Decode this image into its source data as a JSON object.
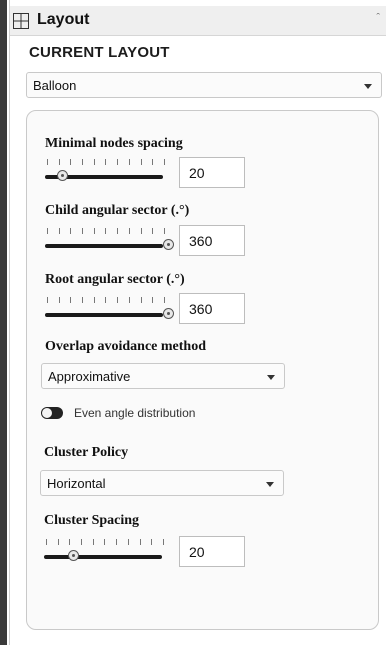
{
  "panel": {
    "title": "Layout",
    "icons": {
      "header": "grid-icon",
      "collapse": "collapse-arrow-icon"
    }
  },
  "current_layout": {
    "heading": "CURRENT LAYOUT",
    "selected": "Balloon"
  },
  "settings": {
    "min_nodes_spacing": {
      "label": "Minimal nodes spacing",
      "value": "20",
      "slider_fraction": 0.1
    },
    "child_angular_sector": {
      "label": "Child angular sector (.°)",
      "value": "360",
      "slider_fraction": 1.0
    },
    "root_angular_sector": {
      "label": "Root angular sector (.°)",
      "value": "360",
      "slider_fraction": 1.0
    },
    "overlap_method": {
      "label": "Overlap avoidance method",
      "selected": "Approximative"
    },
    "even_angle": {
      "label": "Even angle distribution",
      "enabled": false
    },
    "cluster_policy": {
      "label": "Cluster Policy",
      "selected": "Horizontal"
    },
    "cluster_spacing": {
      "label": "Cluster Spacing",
      "value": "20",
      "slider_fraction": 0.2
    }
  }
}
